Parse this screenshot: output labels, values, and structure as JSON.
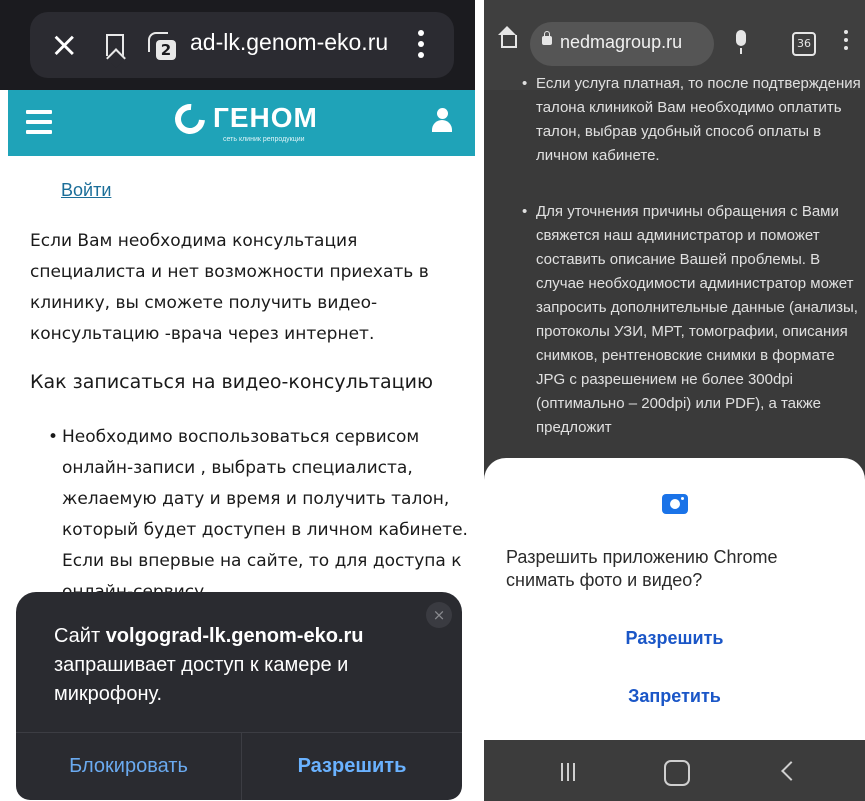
{
  "left": {
    "toolbar": {
      "close_icon": "close-icon",
      "bookmark_icon": "bookmark-icon",
      "tabs_count": "2",
      "url": "ad-lk.genom-eko.ru",
      "menu_icon": "kebab-menu-icon"
    },
    "header": {
      "color": "#1fa3b8",
      "logo_name": "ГЕНОМ",
      "logo_sub": "сеть клиник репродукции"
    },
    "content": {
      "login_link": "Войти",
      "intro": "Если Вам необходима консультация специалиста и нет возможности приехать в клинику, вы сможете получить видео-консультацию -врача через интернет.",
      "heading": "Как записаться на видео-консультацию",
      "bullet": "Необходимо воспользоваться сервисом онлайн-записи , выбрать специалиста, желаемую дату и время и получить талон, который будет доступен в личном кабинете. Если вы впервые на сайте, то для доступа к онлайн-сервису"
    },
    "dialog": {
      "prefix": "Сайт ",
      "site": "volgograd-lk.genom-eko.ru",
      "suffix": " запрашивает доступ к камере и микрофону.",
      "block_label": "Блокировать",
      "allow_label": "Разрешить"
    }
  },
  "right": {
    "toolbar": {
      "url": "nedmagroup.ru",
      "tabs_count": "36"
    },
    "content": {
      "bullet1": "Если услуга платная, то после подтверждения талона клиникой Вам необходимо оплатить талон, выбрав удобный способ оплаты в личном кабинете.",
      "bullet2": "Для уточнения причины обращения с Вами свяжется наш администратор и поможет составить описание Вашей проблемы. В случае необходимости администратор может запросить дополнительные данные (анализы, протоколы УЗИ, МРТ, томографии, описания снимков, рентгеновские снимки в формате JPG с разрешением не более 300dpi (оптимально – 200dpi) или PDF), а также предложит"
    },
    "sheet": {
      "question": "Разрешить приложению Chrome снимать фото и видео?",
      "allow_label": "Разрешить",
      "deny_label": "Запретить"
    },
    "colors": {
      "accent": "#1a73e8"
    }
  }
}
